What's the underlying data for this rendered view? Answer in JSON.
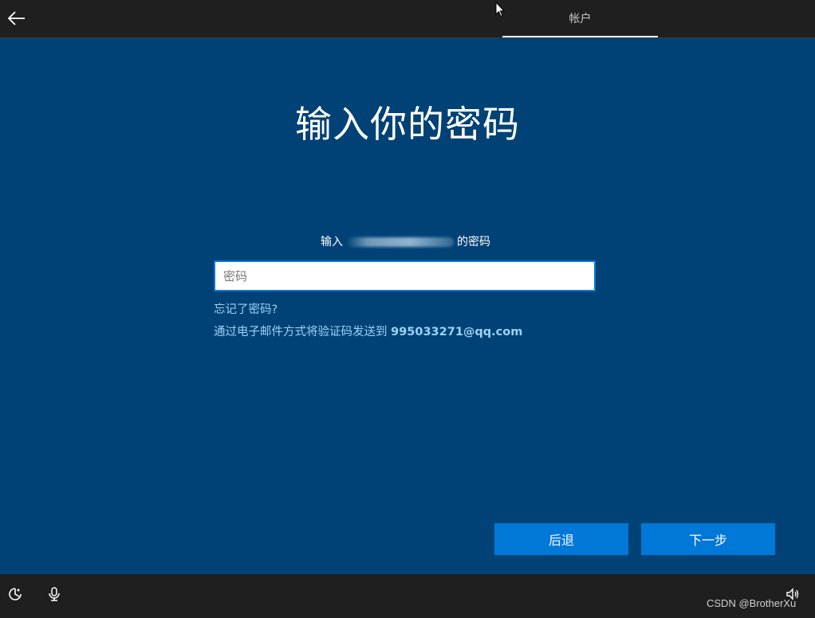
{
  "header": {
    "tab_label": "帐户"
  },
  "main": {
    "title": "输入你的密码",
    "subtitle_prefix": "输入",
    "subtitle_suffix": "的密码",
    "password_placeholder": "密码",
    "password_value": "",
    "forgot_link": "忘记了密码?",
    "email_link_prefix": "通过电子邮件方式将验证码发送到",
    "email_address": "995033271@qq.com"
  },
  "buttons": {
    "back_label": "后退",
    "next_label": "下一步"
  },
  "footer": {
    "watermark": "CSDN @BrotherXu"
  },
  "colors": {
    "background": "#004275",
    "accent": "#0078d7",
    "link": "#9dd1fa",
    "bar": "#1f1f1f"
  }
}
